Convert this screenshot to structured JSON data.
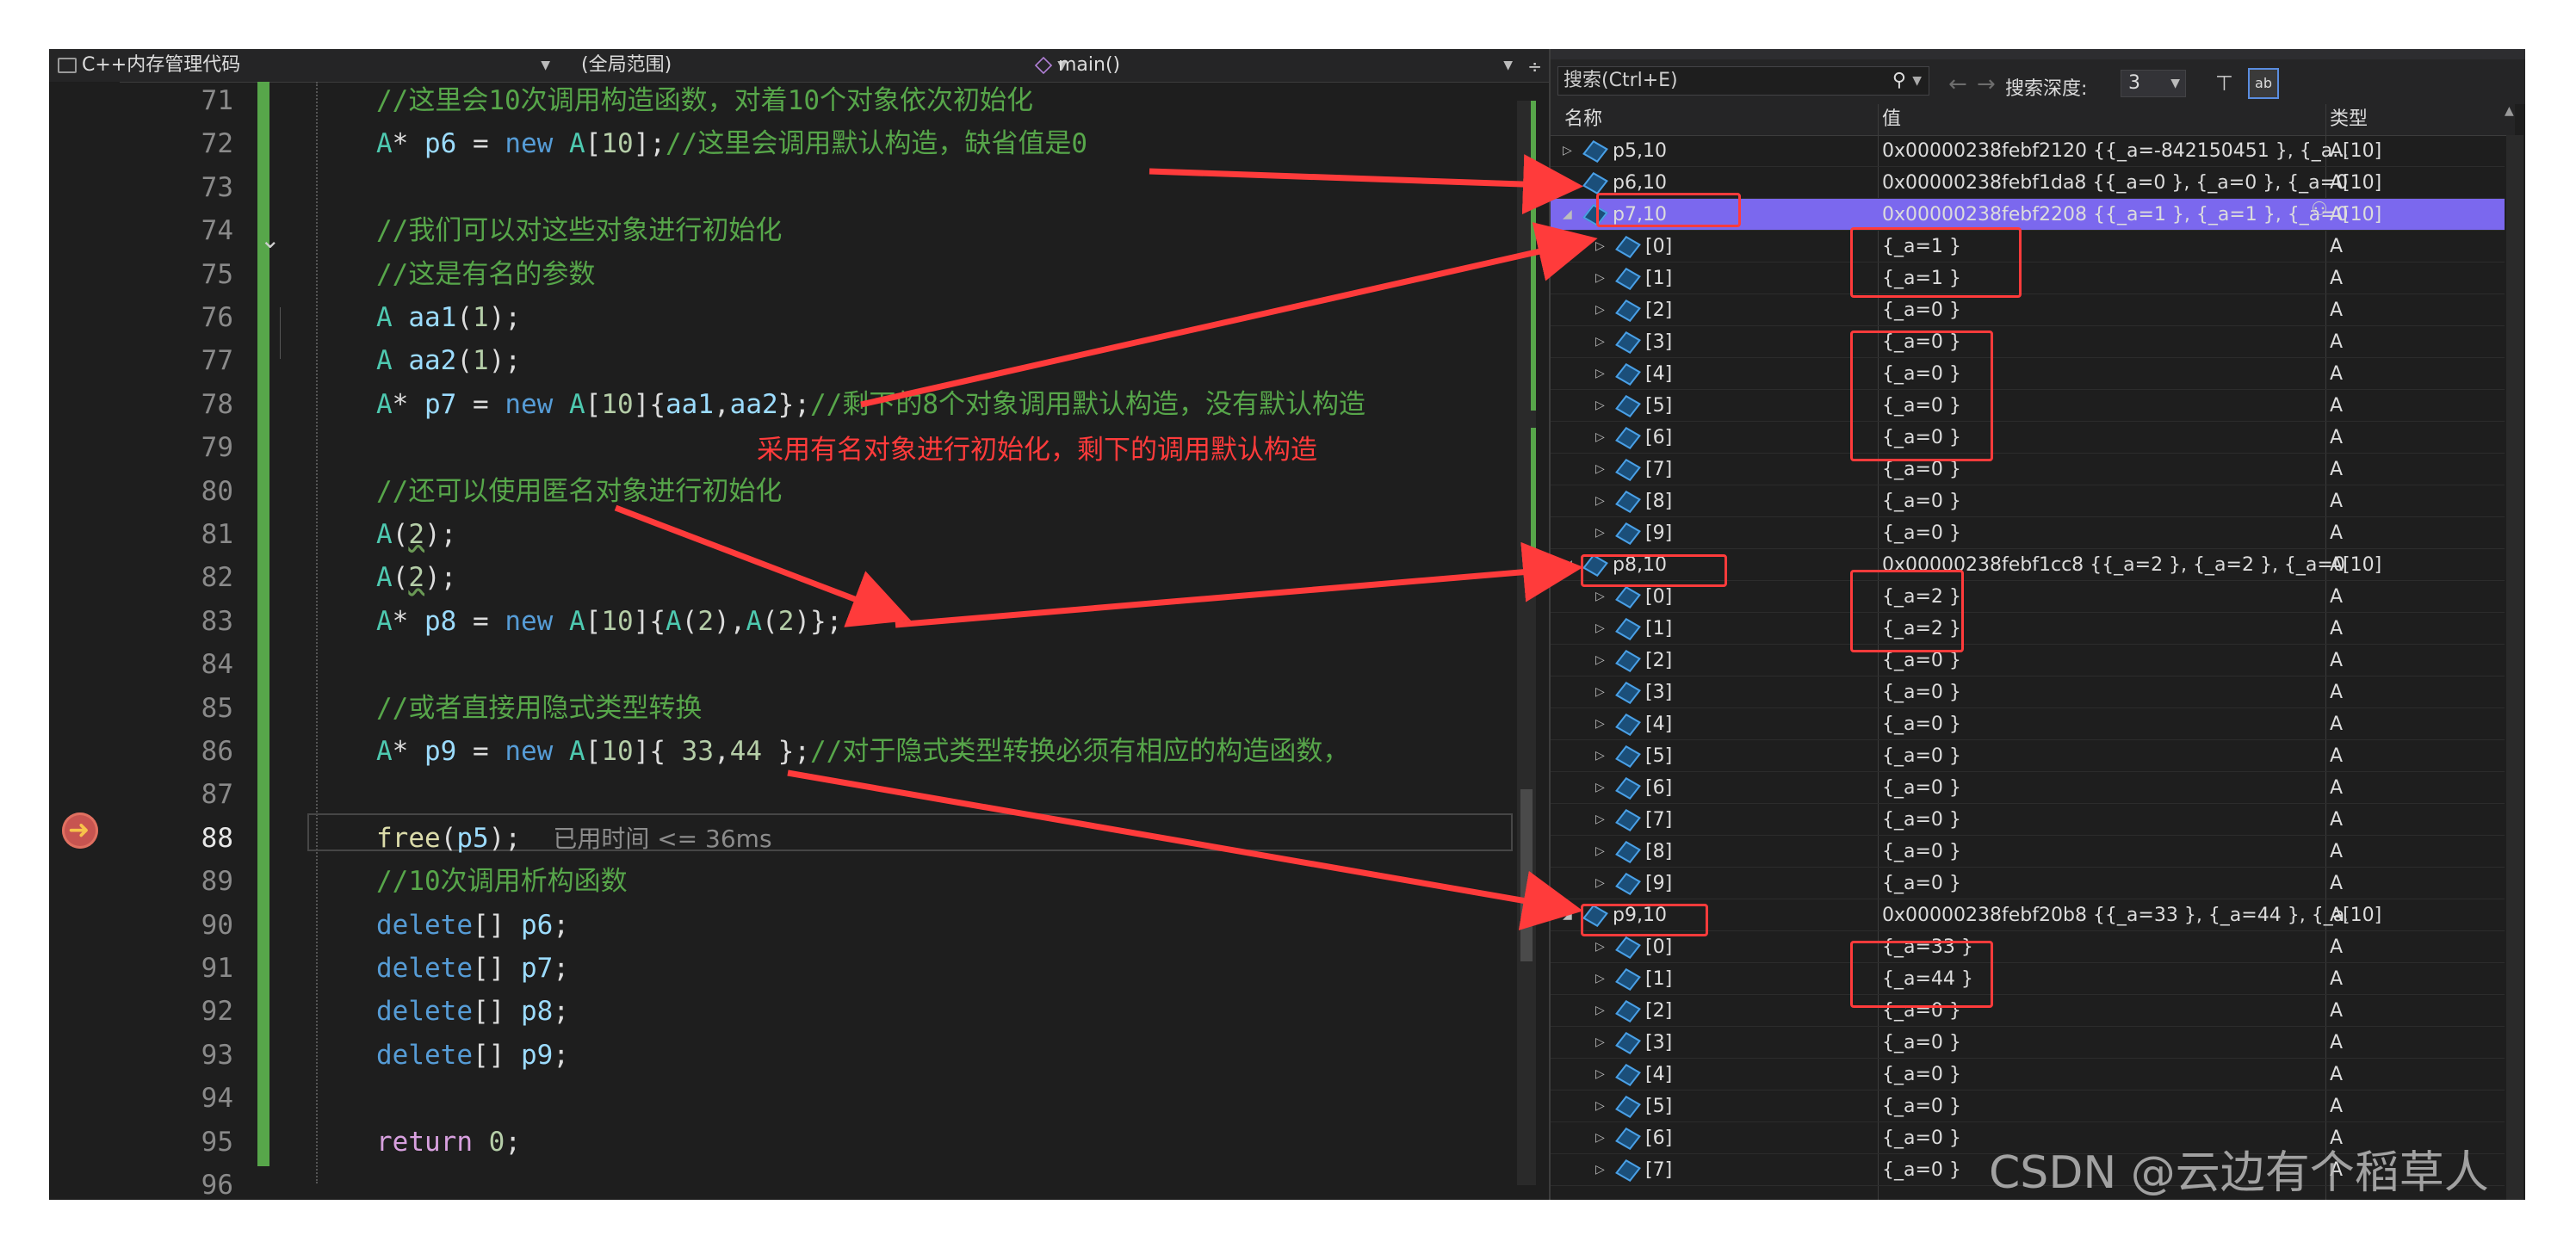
{
  "editor": {
    "nav": {
      "file_dropdown": "C++内存管理代码",
      "scope_dropdown": "(全局范围)",
      "function_dropdown": "main()"
    },
    "lines": [
      {
        "num": "71",
        "parts": [
          {
            "t": "//这里会10次调用构造函数，对着10个对象依次初始化",
            "c": "cm"
          }
        ]
      },
      {
        "num": "72",
        "parts": [
          {
            "t": "A",
            "c": "ty"
          },
          {
            "t": "* "
          },
          {
            "t": "p6",
            "c": "id"
          },
          {
            "t": " = "
          },
          {
            "t": "new",
            "c": "kw"
          },
          {
            "t": " "
          },
          {
            "t": "A",
            "c": "ty"
          },
          {
            "t": "["
          },
          {
            "t": "10",
            "c": "nm"
          },
          {
            "t": "];"
          },
          {
            "t": "//这里会调用默认构造，缺省值是0",
            "c": "cm"
          }
        ]
      },
      {
        "num": "73",
        "parts": []
      },
      {
        "num": "74",
        "parts": [
          {
            "t": "//我们可以对这些对象进行初始化",
            "c": "cm"
          }
        ]
      },
      {
        "num": "75",
        "parts": [
          {
            "t": "//这是有名的参数",
            "c": "cm"
          }
        ]
      },
      {
        "num": "76",
        "parts": [
          {
            "t": "A",
            "c": "ty"
          },
          {
            "t": " "
          },
          {
            "t": "aa1",
            "c": "id"
          },
          {
            "t": "("
          },
          {
            "t": "1",
            "c": "nm"
          },
          {
            "t": ");"
          }
        ]
      },
      {
        "num": "77",
        "parts": [
          {
            "t": "A",
            "c": "ty"
          },
          {
            "t": " "
          },
          {
            "t": "aa2",
            "c": "id"
          },
          {
            "t": "("
          },
          {
            "t": "1",
            "c": "nm"
          },
          {
            "t": ");"
          }
        ]
      },
      {
        "num": "78",
        "parts": [
          {
            "t": "A",
            "c": "ty"
          },
          {
            "t": "* "
          },
          {
            "t": "p7",
            "c": "id"
          },
          {
            "t": " = "
          },
          {
            "t": "new",
            "c": "kw"
          },
          {
            "t": " "
          },
          {
            "t": "A",
            "c": "ty"
          },
          {
            "t": "["
          },
          {
            "t": "10",
            "c": "nm"
          },
          {
            "t": "]{"
          },
          {
            "t": "aa1",
            "c": "id"
          },
          {
            "t": ","
          },
          {
            "t": "aa2",
            "c": "id"
          },
          {
            "t": "};"
          },
          {
            "t": "//剩下的8个对象调用默认构造，没有默认构造",
            "c": "cm"
          }
        ]
      },
      {
        "num": "79",
        "parts": []
      },
      {
        "num": "80",
        "parts": [
          {
            "t": "//还可以使用匿名对象进行初始化",
            "c": "cm"
          }
        ]
      },
      {
        "num": "81",
        "parts": [
          {
            "t": "A",
            "c": "ty"
          },
          {
            "t": "("
          },
          {
            "t": "2",
            "c": "nm squig"
          },
          {
            "t": ");"
          }
        ]
      },
      {
        "num": "82",
        "parts": [
          {
            "t": "A",
            "c": "ty"
          },
          {
            "t": "("
          },
          {
            "t": "2",
            "c": "nm squig"
          },
          {
            "t": ");"
          }
        ]
      },
      {
        "num": "83",
        "parts": [
          {
            "t": "A",
            "c": "ty"
          },
          {
            "t": "* "
          },
          {
            "t": "p8",
            "c": "id"
          },
          {
            "t": " = "
          },
          {
            "t": "new",
            "c": "kw"
          },
          {
            "t": " "
          },
          {
            "t": "A",
            "c": "ty"
          },
          {
            "t": "["
          },
          {
            "t": "10",
            "c": "nm"
          },
          {
            "t": "]{"
          },
          {
            "t": "A",
            "c": "ty"
          },
          {
            "t": "("
          },
          {
            "t": "2",
            "c": "nm"
          },
          {
            "t": "),"
          },
          {
            "t": "A",
            "c": "ty"
          },
          {
            "t": "("
          },
          {
            "t": "2",
            "c": "nm"
          },
          {
            "t": ")};"
          }
        ]
      },
      {
        "num": "84",
        "parts": []
      },
      {
        "num": "85",
        "parts": [
          {
            "t": "//或者直接用隐式类型转换",
            "c": "cm"
          }
        ]
      },
      {
        "num": "86",
        "parts": [
          {
            "t": "A",
            "c": "ty"
          },
          {
            "t": "* "
          },
          {
            "t": "p9",
            "c": "id"
          },
          {
            "t": " = "
          },
          {
            "t": "new",
            "c": "kw"
          },
          {
            "t": " "
          },
          {
            "t": "A",
            "c": "ty"
          },
          {
            "t": "["
          },
          {
            "t": "10",
            "c": "nm"
          },
          {
            "t": "]{ "
          },
          {
            "t": "33",
            "c": "nm"
          },
          {
            "t": ","
          },
          {
            "t": "44",
            "c": "nm"
          },
          {
            "t": " };"
          },
          {
            "t": "//对于隐式类型转换必须有相应的构造函数，",
            "c": "cm"
          }
        ]
      },
      {
        "num": "87",
        "parts": []
      },
      {
        "num": "88",
        "parts": [
          {
            "t": "free",
            "c": "fn"
          },
          {
            "t": "("
          },
          {
            "t": "p5",
            "c": "id"
          },
          {
            "t": ");  "
          },
          {
            "t": "已用时间 <= 36ms",
            "c": "hint"
          }
        ]
      },
      {
        "num": "89",
        "parts": [
          {
            "t": "//10次调用析构函数",
            "c": "cm"
          }
        ]
      },
      {
        "num": "90",
        "parts": [
          {
            "t": "delete",
            "c": "kw"
          },
          {
            "t": "[] "
          },
          {
            "t": "p6",
            "c": "id"
          },
          {
            "t": ";"
          }
        ]
      },
      {
        "num": "91",
        "parts": [
          {
            "t": "delete",
            "c": "kw"
          },
          {
            "t": "[] "
          },
          {
            "t": "p7",
            "c": "id"
          },
          {
            "t": ";"
          }
        ]
      },
      {
        "num": "92",
        "parts": [
          {
            "t": "delete",
            "c": "kw"
          },
          {
            "t": "[] "
          },
          {
            "t": "p8",
            "c": "id"
          },
          {
            "t": ";"
          }
        ]
      },
      {
        "num": "93",
        "parts": [
          {
            "t": "delete",
            "c": "kw"
          },
          {
            "t": "[] "
          },
          {
            "t": "p9",
            "c": "id"
          },
          {
            "t": ";"
          }
        ]
      },
      {
        "num": "94",
        "parts": []
      },
      {
        "num": "95",
        "parts": [
          {
            "t": "return",
            "c": "rt"
          },
          {
            "t": " "
          },
          {
            "t": "0",
            "c": "nm"
          },
          {
            "t": ";"
          }
        ]
      },
      {
        "num": "96",
        "parts": [
          {
            "t": "}"
          }
        ]
      }
    ],
    "current_line": "88",
    "annotation": "采用有名对象进行初始化，剩下的调用默认构造"
  },
  "watch": {
    "search_placeholder": "搜索(Ctrl+E)",
    "search_depth_label": "搜索深度:",
    "search_depth_value": "3",
    "columns": {
      "name": "名称",
      "value": "值",
      "type": "类型"
    },
    "rows": [
      {
        "name": "p5,10",
        "value": "0x00000238febf2120 {{_a=-842150451 }, {_a...",
        "type": "A[10]",
        "level": 0,
        "expanded": false
      },
      {
        "name": "p6,10",
        "value": "0x00000238febf1da8 {{_a=0 }, {_a=0 }, {_a=0 ...",
        "type": "A[10]",
        "level": 0,
        "expanded": false
      },
      {
        "name": "p7,10",
        "value": "0x00000238febf2208 {{_a=1 }, {_a=1 }, {_a=0 ...",
        "type": "A[10]",
        "level": 0,
        "expanded": true,
        "selected": true
      },
      {
        "name": "[0]",
        "value": "{_a=1 }",
        "type": "A",
        "level": 1
      },
      {
        "name": "[1]",
        "value": "{_a=1 }",
        "type": "A",
        "level": 1
      },
      {
        "name": "[2]",
        "value": "{_a=0 }",
        "type": "A",
        "level": 1
      },
      {
        "name": "[3]",
        "value": "{_a=0 }",
        "type": "A",
        "level": 1
      },
      {
        "name": "[4]",
        "value": "{_a=0 }",
        "type": "A",
        "level": 1
      },
      {
        "name": "[5]",
        "value": "{_a=0 }",
        "type": "A",
        "level": 1
      },
      {
        "name": "[6]",
        "value": "{_a=0 }",
        "type": "A",
        "level": 1
      },
      {
        "name": "[7]",
        "value": "{_a=0 }",
        "type": "A",
        "level": 1
      },
      {
        "name": "[8]",
        "value": "{_a=0 }",
        "type": "A",
        "level": 1
      },
      {
        "name": "[9]",
        "value": "{_a=0 }",
        "type": "A",
        "level": 1
      },
      {
        "name": "p8,10",
        "value": "0x00000238febf1cc8 {{_a=2 }, {_a=2 }, {_a=0 }...",
        "type": "A[10]",
        "level": 0,
        "expanded": true
      },
      {
        "name": "[0]",
        "value": "{_a=2 }",
        "type": "A",
        "level": 1
      },
      {
        "name": "[1]",
        "value": "{_a=2 }",
        "type": "A",
        "level": 1
      },
      {
        "name": "[2]",
        "value": "{_a=0 }",
        "type": "A",
        "level": 1
      },
      {
        "name": "[3]",
        "value": "{_a=0 }",
        "type": "A",
        "level": 1
      },
      {
        "name": "[4]",
        "value": "{_a=0 }",
        "type": "A",
        "level": 1
      },
      {
        "name": "[5]",
        "value": "{_a=0 }",
        "type": "A",
        "level": 1
      },
      {
        "name": "[6]",
        "value": "{_a=0 }",
        "type": "A",
        "level": 1
      },
      {
        "name": "[7]",
        "value": "{_a=0 }",
        "type": "A",
        "level": 1
      },
      {
        "name": "[8]",
        "value": "{_a=0 }",
        "type": "A",
        "level": 1
      },
      {
        "name": "[9]",
        "value": "{_a=0 }",
        "type": "A",
        "level": 1
      },
      {
        "name": "p9,10",
        "value": "0x00000238febf20b8 {{_a=33 }, {_a=44 }, {_a...",
        "type": "A[10]",
        "level": 0,
        "expanded": true
      },
      {
        "name": "[0]",
        "value": "{_a=33 }",
        "type": "A",
        "level": 1
      },
      {
        "name": "[1]",
        "value": "{_a=44 }",
        "type": "A",
        "level": 1
      },
      {
        "name": "[2]",
        "value": "{_a=0 }",
        "type": "A",
        "level": 1
      },
      {
        "name": "[3]",
        "value": "{_a=0 }",
        "type": "A",
        "level": 1
      },
      {
        "name": "[4]",
        "value": "{_a=0 }",
        "type": "A",
        "level": 1
      },
      {
        "name": "[5]",
        "value": "{_a=0 }",
        "type": "A",
        "level": 1
      },
      {
        "name": "[6]",
        "value": "{_a=0 }",
        "type": "A",
        "level": 1
      },
      {
        "name": "[7]",
        "value": "{_a=0 }",
        "type": "A",
        "level": 1
      }
    ]
  },
  "watermark": "CSDN @云边有个稻草人",
  "colors": {
    "accent_selection": "#7b68ee",
    "annotation_red": "#ff3b3b",
    "comment_green": "#57a64a"
  }
}
